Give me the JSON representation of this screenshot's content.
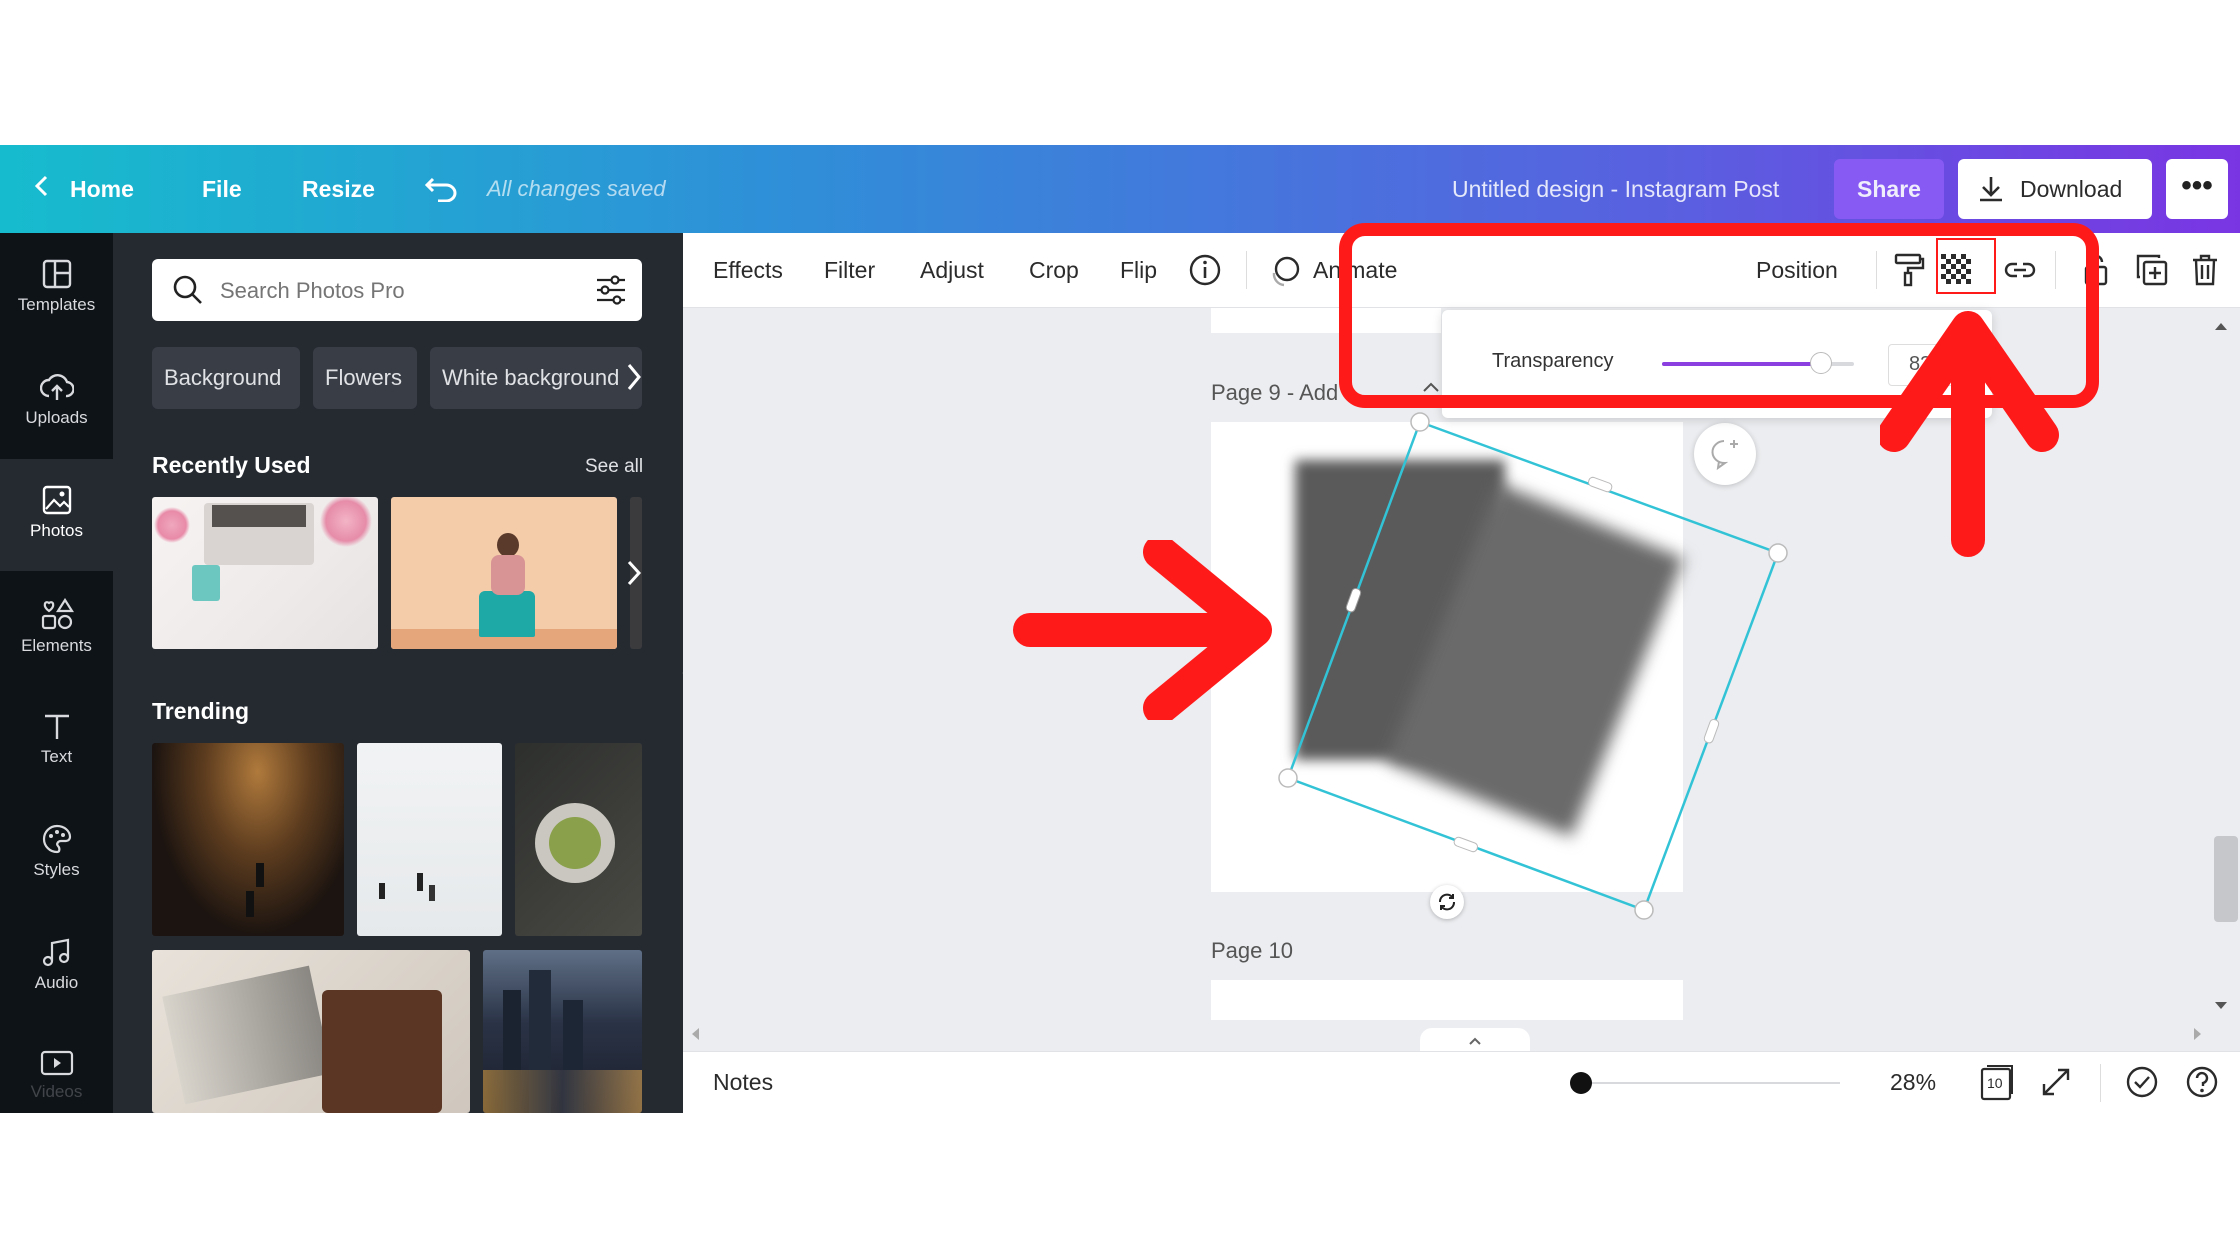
{
  "topbar": {
    "home_label": "Home",
    "file_label": "File",
    "resize_label": "Resize",
    "save_status": "All changes saved",
    "design_title": "Untitled design - Instagram Post",
    "share_label": "Share",
    "download_label": "Download"
  },
  "rail": {
    "items": [
      {
        "label": "Templates",
        "icon": "templates-icon"
      },
      {
        "label": "Uploads",
        "icon": "upload-icon"
      },
      {
        "label": "Photos",
        "icon": "photo-icon"
      },
      {
        "label": "Elements",
        "icon": "elements-icon"
      },
      {
        "label": "Text",
        "icon": "text-icon"
      },
      {
        "label": "Styles",
        "icon": "palette-icon"
      },
      {
        "label": "Audio",
        "icon": "music-icon"
      },
      {
        "label": "Videos",
        "icon": "video-icon"
      }
    ]
  },
  "panel": {
    "search_placeholder": "Search Photos Pro",
    "chips": [
      "Background",
      "Flowers",
      "White background"
    ],
    "recent_title": "Recently Used",
    "see_all": "See all",
    "trending_title": "Trending"
  },
  "toolbar": {
    "effects": "Effects",
    "filter": "Filter",
    "adjust": "Adjust",
    "crop": "Crop",
    "flip": "Flip",
    "animate": "Animate",
    "position": "Position"
  },
  "transparency": {
    "label": "Transparency",
    "value": "83",
    "fraction": 0.83
  },
  "canvas": {
    "page9_label": "Page 9 - Add a",
    "page10_label": "Page 10"
  },
  "bottombar": {
    "notes": "Notes",
    "zoom": "28%",
    "page_count": "10"
  },
  "colors": {
    "accent": "#8b5cf6",
    "selection": "#33c3d6",
    "annotation": "#ff1a1a"
  }
}
